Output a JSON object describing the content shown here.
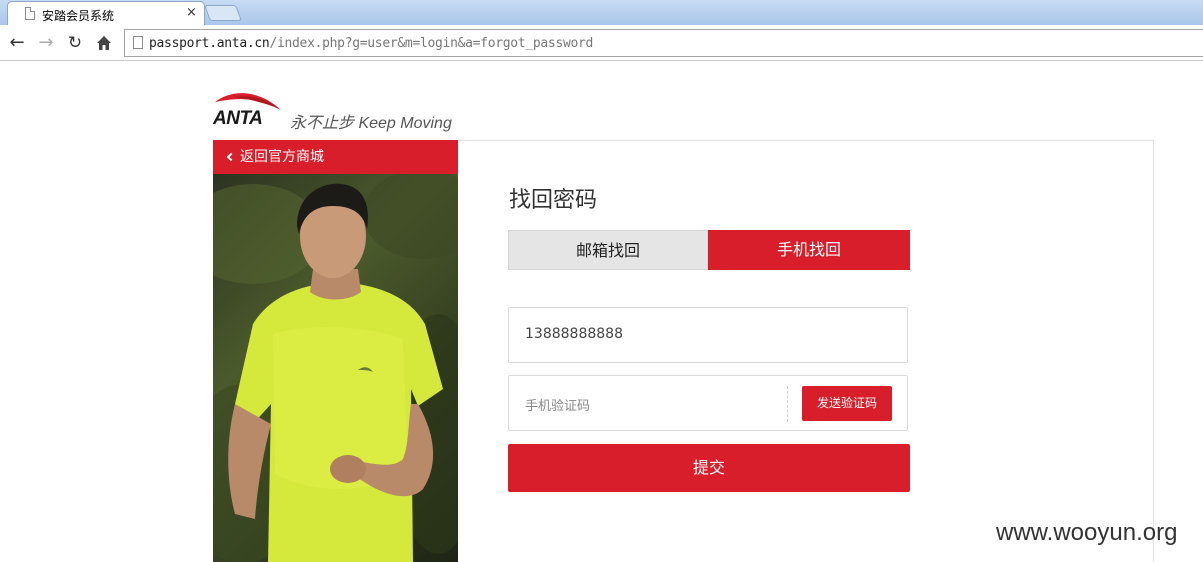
{
  "browser": {
    "tab_title": "安踏会员系统",
    "tab_close": "×",
    "url_host": "passport.anta.cn",
    "url_path": "/index.php?g=user&m=login&a=forgot_password"
  },
  "logo": {
    "brand": "ANTA",
    "slogan": "永不止步 Keep Moving"
  },
  "sidebar": {
    "back_link": "返回官方商城"
  },
  "form": {
    "title": "找回密码",
    "tabs": [
      {
        "label": "邮箱找回",
        "active": false
      },
      {
        "label": "手机找回",
        "active": true
      }
    ],
    "phone_value": "13888888888",
    "code_placeholder": "手机验证码",
    "send_code_label": "发送验证码",
    "submit_label": "提交"
  },
  "watermark": "www.wooyun.org",
  "colors": {
    "accent": "#d81e2a",
    "tab_inactive": "#e5e5e5"
  }
}
